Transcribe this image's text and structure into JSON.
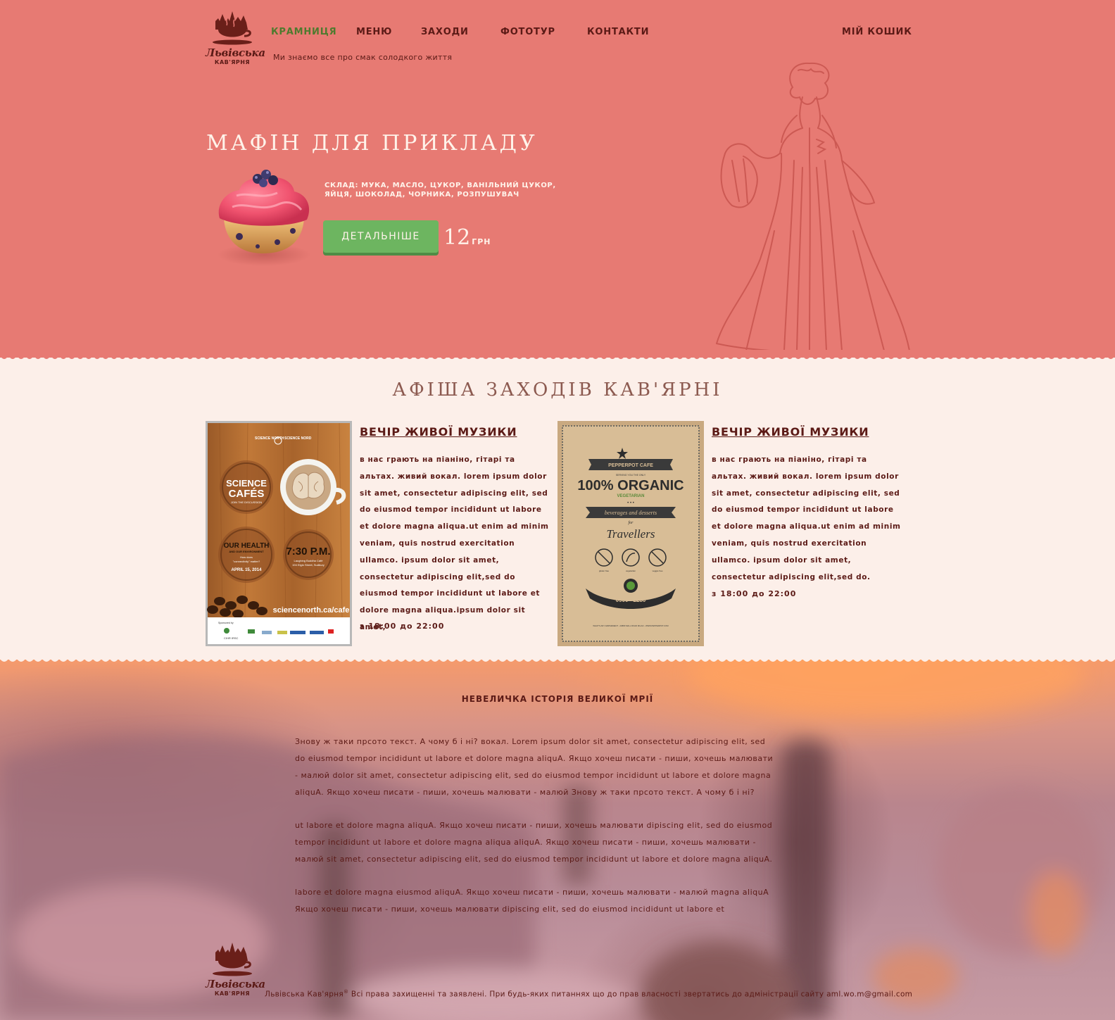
{
  "header": {
    "brand_name": "Львівська",
    "brand_sub": "КАВ'ЯРНЯ",
    "nav": [
      {
        "label": "КРАМНИЦЯ",
        "active": true
      },
      {
        "label": "МЕНЮ",
        "active": false
      },
      {
        "label": "ЗАХОДИ",
        "active": false
      },
      {
        "label": "ФОТОТУР",
        "active": false
      },
      {
        "label": "КОНТАКТИ",
        "active": false
      }
    ],
    "cart_label": "МІЙ КОШИК",
    "tagline": "Ми знаємо все про смак солодкого життя"
  },
  "hero": {
    "title": "МАФІН ДЛЯ ПРИКЛАДУ",
    "ingredients": "СКЛАД: МУКА, МАСЛО, ЦУКОР, ВАНІЛЬНИЙ ЦУКОР, ЯЙЦЯ, ШОКОЛАД, ЧОРНИКА, РОЗПУШУВАЧ",
    "details_button": "ДЕТАЛЬНІШЕ",
    "price": "12",
    "currency": "ГРН"
  },
  "events": {
    "title": "АФІША ЗАХОДІВ КАВ'ЯРНІ",
    "items": [
      {
        "name": "ВЕЧІР ЖИВОЇ МУЗИКИ",
        "description": "в нас грають на піаніно, гітарі та альтах. живий вокал. lorem ipsum dolor sit amet, consectetur adipiscing elit, sed do eiusmod tempor incididunt ut labore et dolore magna aliqua.ut enim ad minim veniam, quis nostrud exercitation ullamco. ipsum dolor sit amet, consectetur adipiscing elit,sed do eiusmod tempor incididunt ut labore et dolore magna aliqua.ipsum dolor sit amet,",
        "time": "з 18:00 до 22:00",
        "poster": {
          "top_left": "SCIENCE NORTH",
          "top_right": "SCIENCE NORD",
          "headline_1": "SCIENCE",
          "headline_2": "CAFÉS",
          "subhead": "JOIN THE DISCUSSION",
          "topic_1": "OUR HEALTH",
          "topic_2": "AND OUR ENVIRONMENT",
          "topic_3": "How does",
          "topic_4": "\"connectivity\" matter?",
          "date": "APRIL 15, 2014",
          "time": "7:30 P.M.",
          "venue_1": "Laughing Buddha Café",
          "venue_2": "194 Elgin Street, Sudbury",
          "url": "sciencenorth.ca/cafe",
          "sponsor_note": "Sponsored by",
          "sponsor": "CIHR IRSC"
        }
      },
      {
        "name": "ВЕЧІР ЖИВОЇ МУЗИКИ",
        "description": "в нас грають на піаніно, гітарі та альтах. живий вокал. lorem ipsum dolor sit amet, consectetur adipiscing elit, sed do eiusmod tempor incididunt ut labore et dolore magna aliqua.ut enim ad minim veniam, quis nostrud exercitation ullamco. ipsum dolor sit amet, consectetur adipiscing elit,sed do.",
        "time": "з 18:00 до 22:00",
        "poster": {
          "ribbon": "PEPPERPOT CAFE",
          "serving": "SERVING YOU THE ONLY",
          "headline": "100% ORGANIC",
          "sub": "VEGETARIAN",
          "script_1": "beverages and desserts",
          "script_2": "for",
          "script_3": "Travellers",
          "icon_label_1": "gluten free",
          "icon_label_2": "vegetarian",
          "icon_label_3": "veggie free",
          "phone": "0900 - 2280",
          "footer": "WHAT'S ANY ARRIVEMENT - 20880 MALL ROAD MILAN - WWW.PEPPERPOT.COM"
        }
      }
    ]
  },
  "history": {
    "title": "НЕВЕЛИЧКА ІСТОРІЯ ВЕЛИКОЇ МРІЇ",
    "paragraphs": [
      "Знову ж таки прсото текст. А чому б і ні? вокал. Lorem ipsum dolor sit amet, consectetur adipiscing elit, sed do eiusmod tempor incididunt ut labore et dolore magna aliquA. Якщо хочеш писати - пиши, хочешь малювати - малюй dolor sit amet, consectetur adipiscing elit, sed do eiusmod tempor incididunt ut labore et dolore magna aliquA. Якщо хочеш писати - пиши, хочешь малювати - малюй Знову ж таки прсото текст. А чому б і ні?",
      "ut labore et dolore magna aliquA. Якщо хочеш писати - пиши, хочешь малювати dipiscing elit, sed do eiusmod tempor incididunt ut labore et dolore magna aliqua aliquA. Якщо хочеш писати - пиши, хочешь малювати - малюй sit amet, consectetur adipiscing elit, sed do eiusmod tempor incididunt ut labore et dolore magna aliquA.",
      "labore et dolore magna eiusmod aliquA. Якщо хочеш писати - пиши, хочешь малювати - малюй magna aliquA Якщо хочеш писати - пиши, хочешь малювати dipiscing elit, sed do eiusmod incididunt ut labore et"
    ]
  },
  "footer": {
    "brand_name": "Львівська",
    "brand_sub": "КАВ'ЯРНЯ",
    "copyright_name": "Львівська Кав'ярня",
    "registered": "®",
    "copyright_text": " Всі права захищенні та заявлені. При будь-яких питаннях що до прав власності звертатись до адміністрації сайту aml.wo.m@gmail.com"
  },
  "colors": {
    "hero_bg": "#e77a73",
    "cream_bg": "#fcefe9",
    "brand_brown": "#5b1a16",
    "nav_active": "#4f7a2e",
    "button_green": "#6db560",
    "events_title": "#8c5a50"
  }
}
